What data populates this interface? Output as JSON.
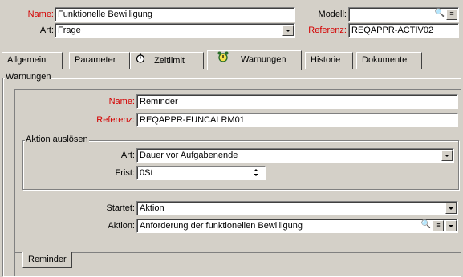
{
  "header": {
    "name_label": "Name:",
    "name_value": "Funktionelle Bewilligung",
    "art_label": "Art:",
    "art_value": "Frage",
    "modell_label": "Modell:",
    "modell_value": "",
    "referenz_label": "Referenz:",
    "referenz_value": "REQAPPR-ACTIV02"
  },
  "tabs": [
    {
      "label": "Allgemein",
      "icon": ""
    },
    {
      "label": "Parameter",
      "icon": ""
    },
    {
      "label": "Zeitlimit",
      "icon": "stopwatch-icon"
    },
    {
      "label": "Warnungen",
      "icon": "alarm-clock-icon"
    },
    {
      "label": "Historie",
      "icon": ""
    },
    {
      "label": "Dokumente",
      "icon": ""
    }
  ],
  "active_tab": "Warnungen",
  "warnungen": {
    "group_title": "Warnungen",
    "name_label": "Name:",
    "name_value": "Reminder",
    "referenz_label": "Referenz:",
    "referenz_value": "REQAPPR-FUNCALRM01",
    "aktion_group_title": "Aktion auslösen",
    "art_label": "Art:",
    "art_value": "Dauer vor Aufgabenende",
    "frist_label": "Frist:",
    "frist_value": "0St",
    "startet_label": "Startet:",
    "startet_value": "Aktion",
    "aktion_label": "Aktion:",
    "aktion_value": "Anforderung der funktionellen Bewilligung",
    "bottom_tab": "Reminder"
  },
  "colors": {
    "background": "#d4d0c8",
    "required_label": "#d40000",
    "field_bg": "#ffffff"
  }
}
